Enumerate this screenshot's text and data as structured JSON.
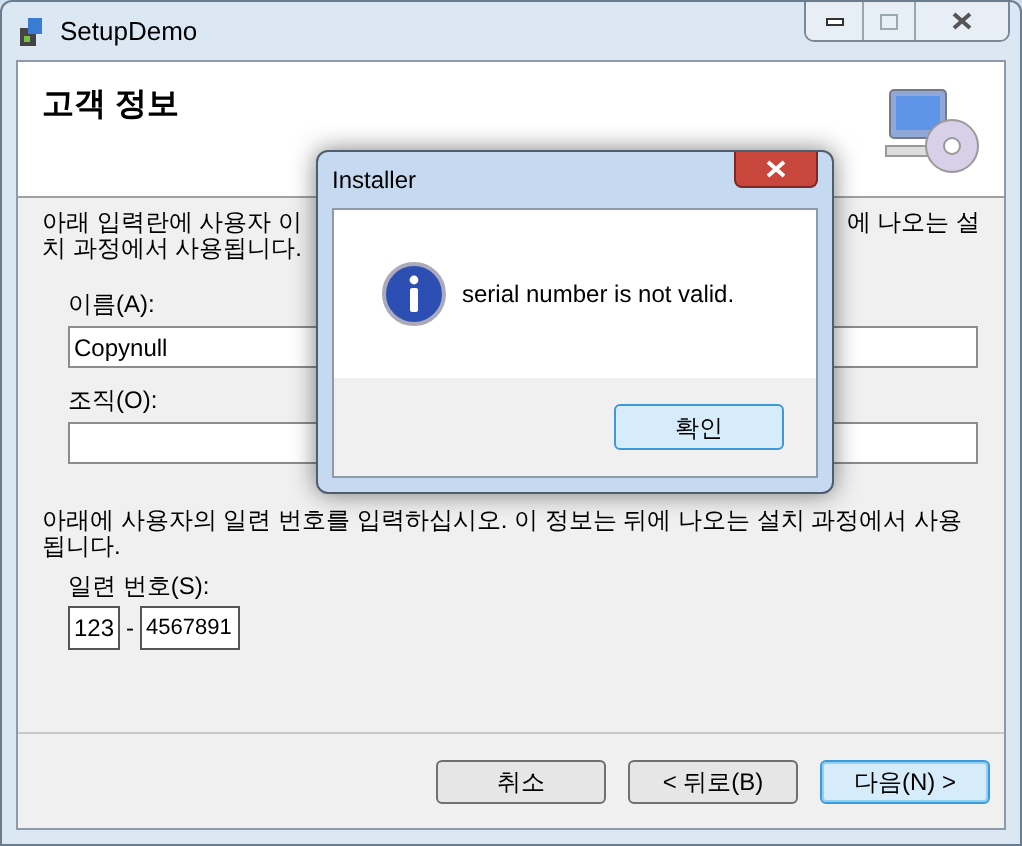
{
  "window": {
    "title": "SetupDemo"
  },
  "header": {
    "title": "고객 정보"
  },
  "intro": {
    "line_1_left": "아래 입력란에 사용자 이",
    "line_1_right": "에 나오는 설",
    "line_2": "치 과정에서 사용됩니다."
  },
  "fields": [
    {
      "label": "이름(A):",
      "value": "Copynull"
    },
    {
      "label": "조직(O):"
    }
  ],
  "serial": {
    "text": "아래에 사용자의 일련 번호를 입력하십시오. 이 정보는 뒤에 나오는 설치 과정에서 사용됩니다.",
    "label": "일련 번호(S):",
    "part_1": "123",
    "separator": "-",
    "part_2": "4567891"
  },
  "buttons": [
    {
      "label": "취소",
      "default": false
    },
    {
      "label": "< 뒤로(B)",
      "default": false
    },
    {
      "label": "다음(N) >",
      "default": true
    }
  ],
  "dialog": {
    "title": "Installer",
    "message": "serial number is not valid.",
    "button": "확인"
  }
}
